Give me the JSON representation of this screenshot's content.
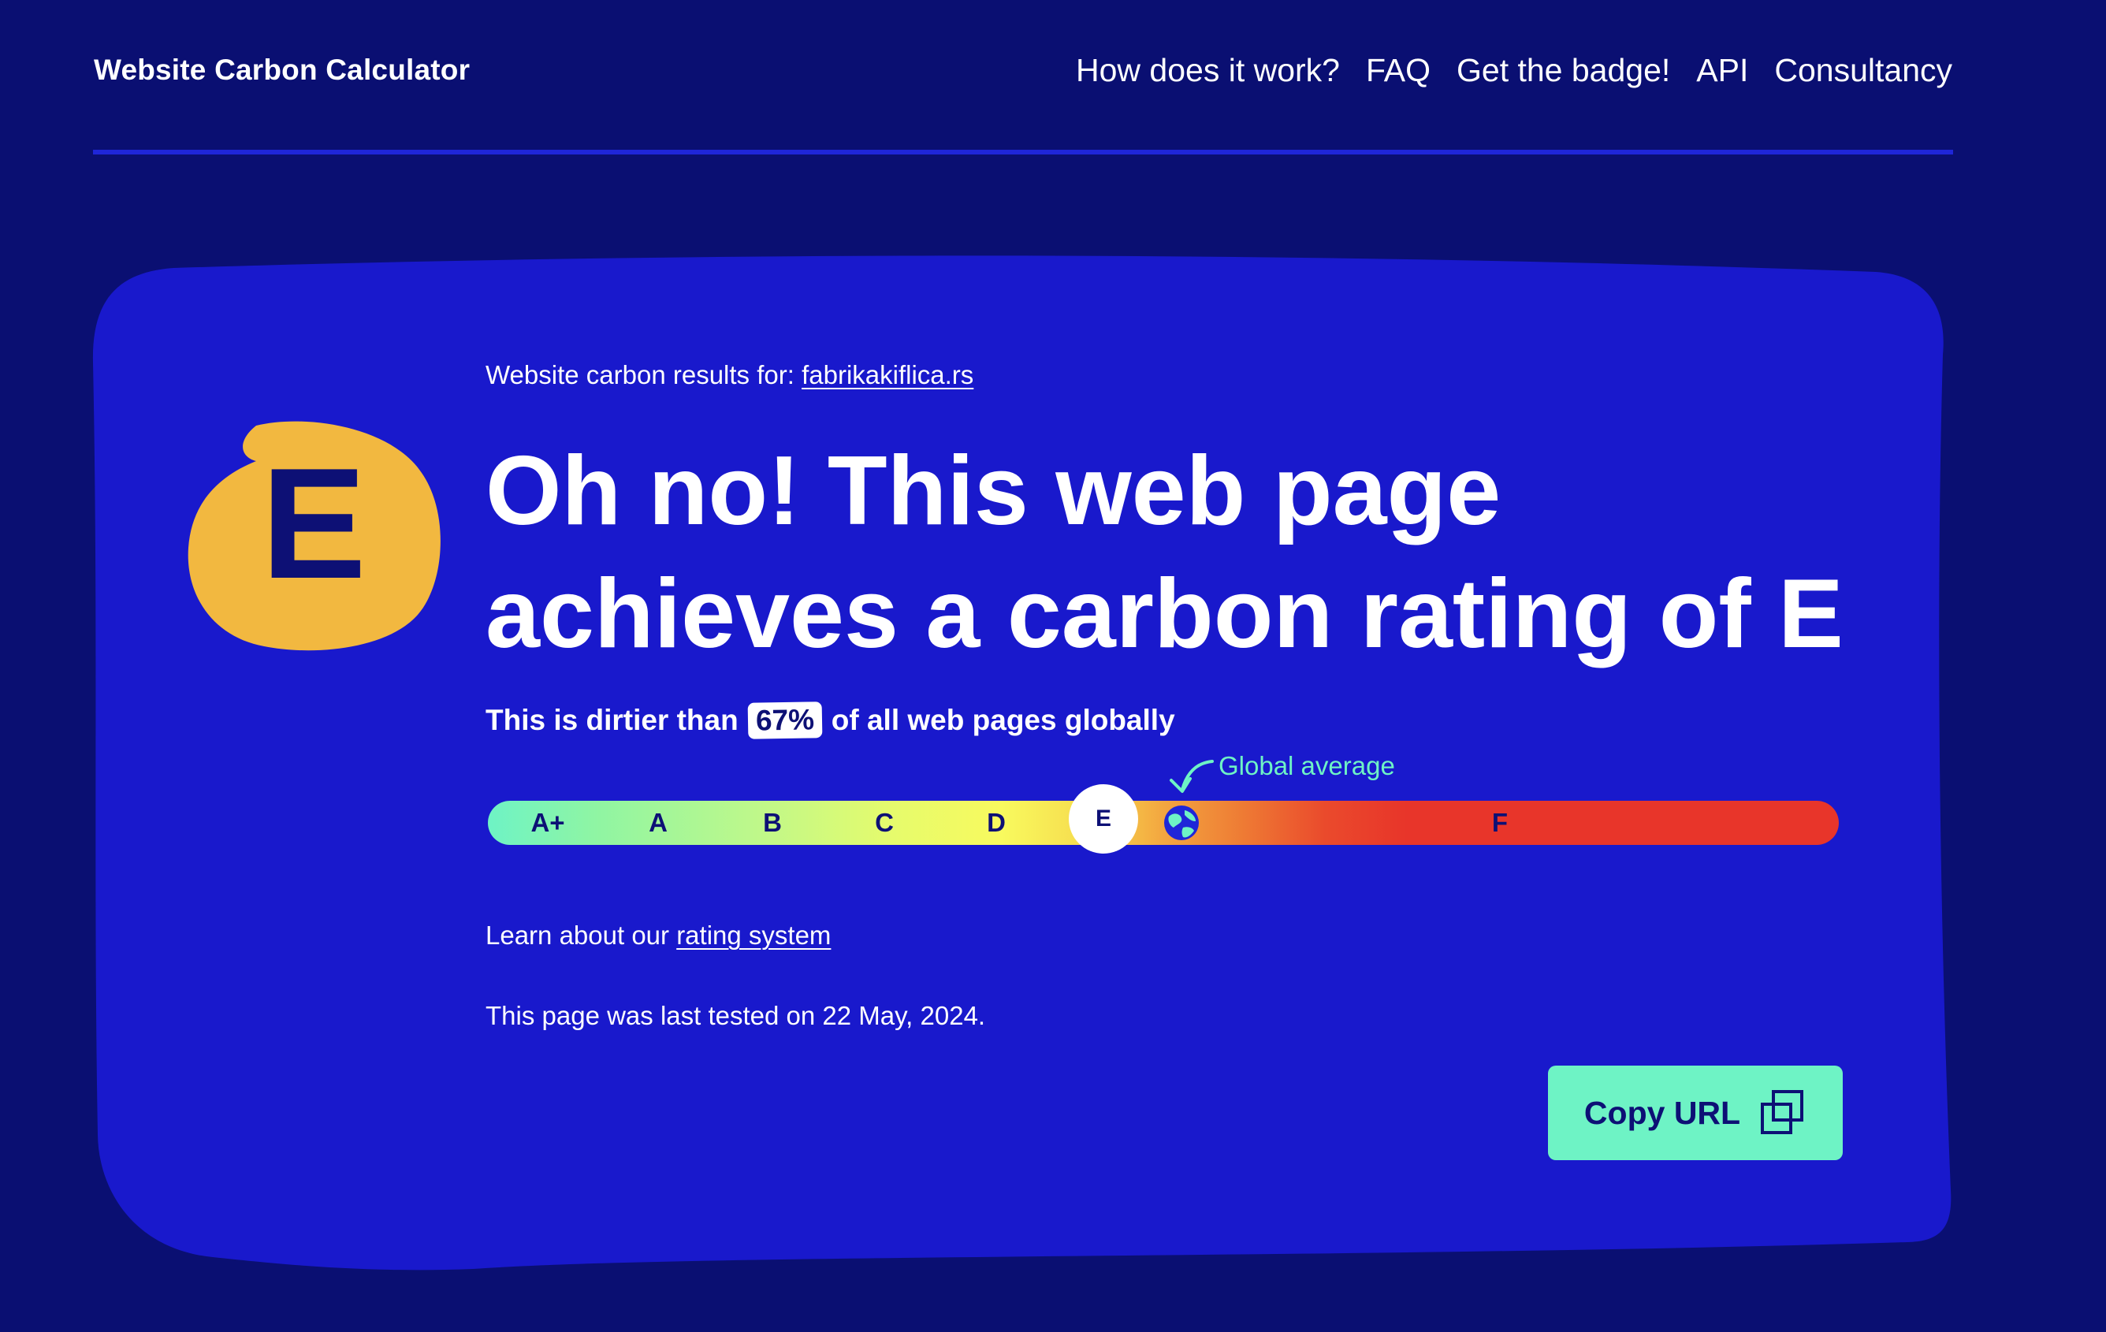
{
  "header": {
    "brand": "Website Carbon Calculator",
    "nav": [
      {
        "label": "How does it work?"
      },
      {
        "label": "FAQ"
      },
      {
        "label": "Get the badge!"
      },
      {
        "label": "API"
      },
      {
        "label": "Consultancy"
      }
    ]
  },
  "result": {
    "intro_label": "Website carbon results for:",
    "site": "fabrikakiflica.rs",
    "grade": "E",
    "headline": "Oh no! This web page achieves a carbon rating of E",
    "dirtier_prefix": "This is dirtier than",
    "dirtier_percent": "67%",
    "dirtier_suffix": "of all web pages globally"
  },
  "scale": {
    "grades": [
      "A+",
      "A",
      "B",
      "C",
      "D",
      "E",
      "F"
    ],
    "current": "E",
    "global_average_label": "Global average"
  },
  "footer_info": {
    "learn_prefix": "Learn about our",
    "learn_link": "rating system",
    "tested": "This page was last tested on 22 May, 2024."
  },
  "actions": {
    "copy_url_label": "Copy URL"
  },
  "colors": {
    "page_bg": "#0a0f72",
    "card_bg": "#1919cc",
    "badge_yellow": "#f2b840",
    "accent_green": "#6ef3c5",
    "rating_red": "#e8352a"
  },
  "icons": [
    "globe-icon",
    "copy-icon",
    "curved-arrow-icon"
  ]
}
